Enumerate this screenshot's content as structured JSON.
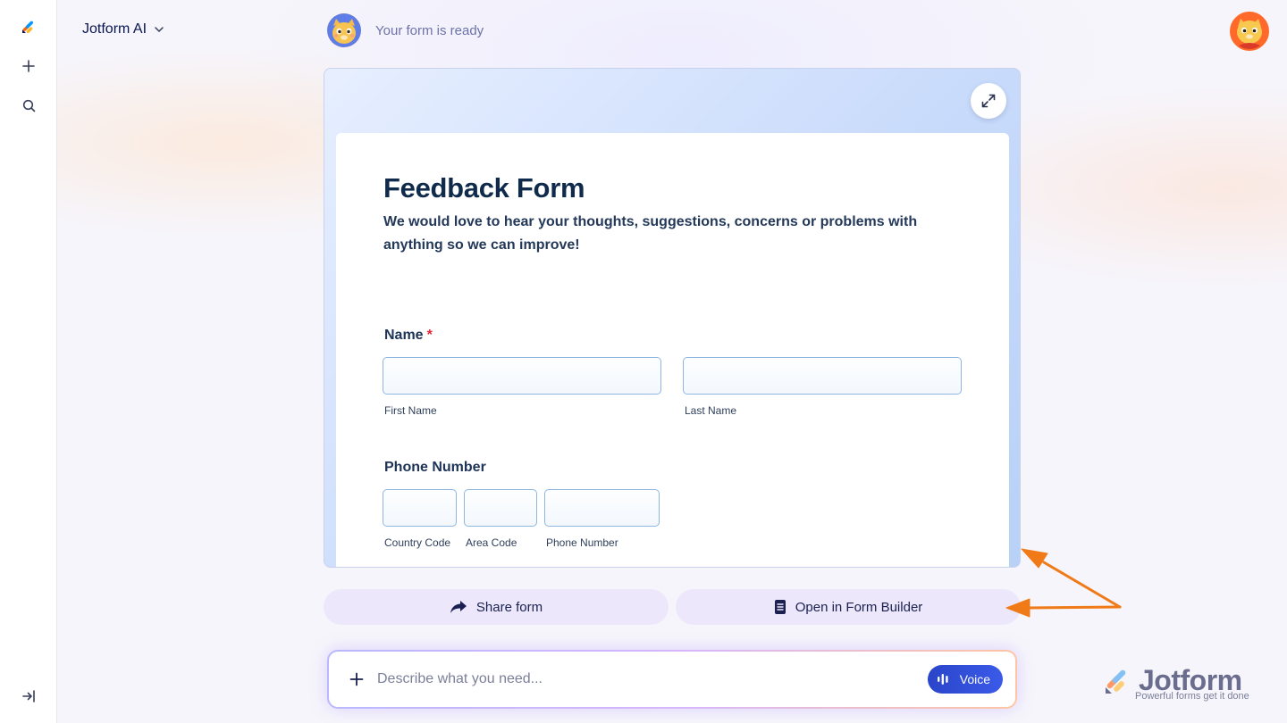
{
  "app": {
    "title": "Jotform AI"
  },
  "assistant": {
    "status": "Your form is ready"
  },
  "form": {
    "title": "Feedback Form",
    "description": "We would love to hear your thoughts, suggestions, concerns or problems with anything so we can improve!",
    "questions": {
      "name": {
        "label": "Name",
        "required_mark": "*",
        "first": "First Name",
        "last": "Last Name"
      },
      "phone": {
        "label": "Phone Number",
        "country": "Country Code",
        "area": "Area Code",
        "number": "Phone Number"
      }
    }
  },
  "actions": {
    "share": "Share form",
    "open_builder": "Open in Form Builder"
  },
  "prompt": {
    "placeholder": "Describe what you need...",
    "voice": "Voice"
  },
  "watermark": {
    "brand": "Jotform",
    "tagline": "Powerful forms get it done"
  },
  "colors": {
    "accent": "#2a45c9",
    "annotation_arrow": "#f07a18",
    "required": "#e0283a"
  }
}
